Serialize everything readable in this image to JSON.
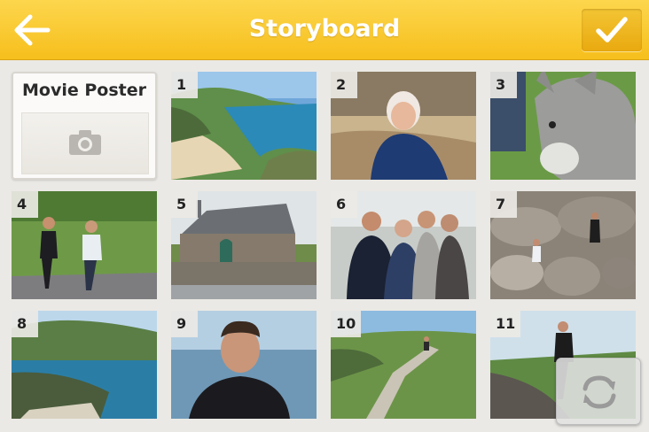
{
  "header": {
    "title": "Storyboard",
    "back_icon": "arrow-left-icon",
    "done_icon": "checkmark-icon",
    "accent_color": "#f8c52a"
  },
  "poster": {
    "label": "Movie Poster",
    "icon": "camera-icon"
  },
  "tiles": [
    {
      "number": "1"
    },
    {
      "number": "2"
    },
    {
      "number": "3"
    },
    {
      "number": "4"
    },
    {
      "number": "5"
    },
    {
      "number": "6"
    },
    {
      "number": "7"
    },
    {
      "number": "8"
    },
    {
      "number": "9"
    },
    {
      "number": "10"
    },
    {
      "number": "11"
    }
  ],
  "rotate_button": {
    "icon": "rotate-arrows-icon"
  }
}
